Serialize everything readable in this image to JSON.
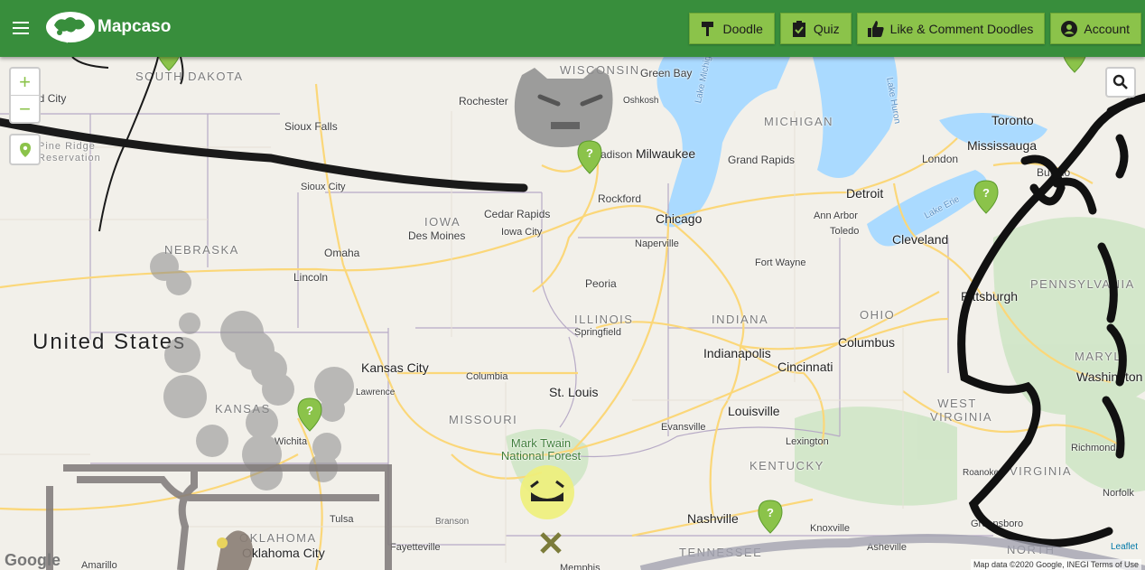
{
  "header": {
    "brand": "Mapcaso",
    "nav": [
      {
        "label": "Doodle",
        "icon": "paint-roller-icon"
      },
      {
        "label": "Quiz",
        "icon": "clipboard-check-icon"
      },
      {
        "label": "Like & Comment Doodles",
        "icon": "thumbs-up-icon"
      },
      {
        "label": "Account",
        "icon": "account-circle-icon"
      }
    ]
  },
  "map": {
    "zoom_in": "+",
    "zoom_out": "−",
    "google": "Google",
    "attribution": "Map data ©2020 Google, INEGI   Terms of Use",
    "leaflet": "Leaflet",
    "labels": {
      "country": "United States",
      "states": [
        "SOUTH DAKOTA",
        "WISCONSIN",
        "MICHIGAN",
        "IOWA",
        "NEBRASKA",
        "ILLINOIS",
        "INDIANA",
        "OHIO",
        "PENNSYLVANIA",
        "KANSAS",
        "MISSOURI",
        "WEST VIRGINIA",
        "KENTUCKY",
        "VIRGINIA",
        "TENNESSEE",
        "OKLAHOMA",
        "NORTH",
        "MARYL"
      ],
      "cities_major": [
        "Milwaukee",
        "Chicago",
        "Detroit",
        "Toronto",
        "Mississauga",
        "Cleveland",
        "Pittsburgh",
        "Kansas City",
        "St. Louis",
        "Indianapolis",
        "Columbus",
        "Cincinnati",
        "Louisville",
        "Nashville",
        "Washington",
        "Oklahoma City"
      ],
      "cities_minor": [
        "Rapid City",
        "Sioux Falls",
        "Rochester",
        "Green Bay",
        "Oshkosh",
        "Madison",
        "Sioux City",
        "Grand Rapids",
        "London",
        "Buffalo",
        "Rockford",
        "Cedar Rapids",
        "Des Moines",
        "Iowa City",
        "Ann Arbor",
        "Toledo",
        "Naperville",
        "Omaha",
        "Lincoln",
        "Fort Wayne",
        "Peoria",
        "Springfield",
        "Columbia",
        "Lawrence",
        "Wichita",
        "Evansville",
        "Lexington",
        "Richmond",
        "Norfolk",
        "Roanoke",
        "Knoxville",
        "Asheville",
        "Greensboro",
        "Tulsa",
        "Fayetteville",
        "Branson",
        "Amarillo",
        "Memphis",
        "Pine Ridge Reservation"
      ],
      "parks": [
        "Mark Twain National Forest"
      ],
      "water": [
        "Lake Michigan",
        "Lake Huron",
        "Lake Erie"
      ]
    },
    "pins": [
      {
        "name": "doodle-pin-madison"
      },
      {
        "name": "doodle-pin-kansas"
      },
      {
        "name": "doodle-pin-tennessee"
      },
      {
        "name": "doodle-pin-pennsylvania"
      },
      {
        "name": "doodle-pin-michigan"
      },
      {
        "name": "doodle-pin-south-dakota"
      }
    ]
  },
  "colors": {
    "header": "#388e3c",
    "button": "#8bc34a",
    "water": "#aadaff",
    "highway": "#fde293",
    "doodle_black": "#1a1a1a",
    "doodle_gray": "#9e9e9e"
  }
}
